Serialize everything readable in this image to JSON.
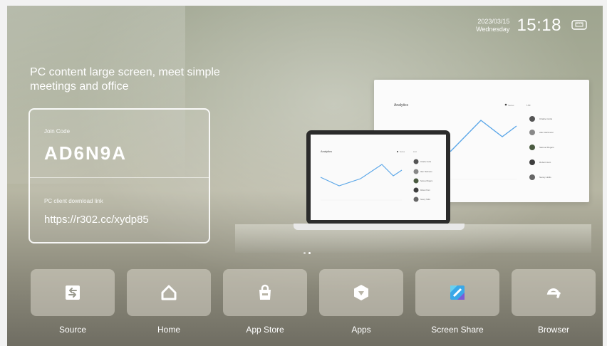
{
  "status": {
    "date": "2023/03/15",
    "weekday": "Wednesday",
    "time": "15:18",
    "network_icon": "ethernet-icon"
  },
  "tagline": "PC content large screen, meet simple meetings and office",
  "join_card": {
    "code_label": "Join Code",
    "code": "AD6N9A",
    "download_label": "PC client download link",
    "download_link": "https://r302.cc/xydp85"
  },
  "illustration": {
    "monitor": {
      "title": "Analytics",
      "legend": "Series",
      "list_header": "List",
      "list_items": [
        "Charlie Curtis",
        "Alan Hartmann",
        "Samuel Rogers",
        "Robert Hunt",
        "Nancy Hollis"
      ]
    },
    "laptop": {
      "title": "Analytics",
      "legend": "Series",
      "list_header": "List",
      "list_items": [
        "Charlie Curtis",
        "Alan Hartmann",
        "Samuel Rogers",
        "Robert Hunt",
        "Nancy Hollis"
      ]
    }
  },
  "pager": {
    "count": 2,
    "active": 2
  },
  "dock": [
    {
      "label": "Source",
      "icon": "source-input-icon"
    },
    {
      "label": "Home",
      "icon": "home-icon"
    },
    {
      "label": "App Store",
      "icon": "app-store-bag-icon"
    },
    {
      "label": "Apps",
      "icon": "apps-hexagon-icon"
    },
    {
      "label": "Screen Share",
      "icon": "screen-share-icon"
    },
    {
      "label": "Browser",
      "icon": "browser-e-icon"
    }
  ]
}
